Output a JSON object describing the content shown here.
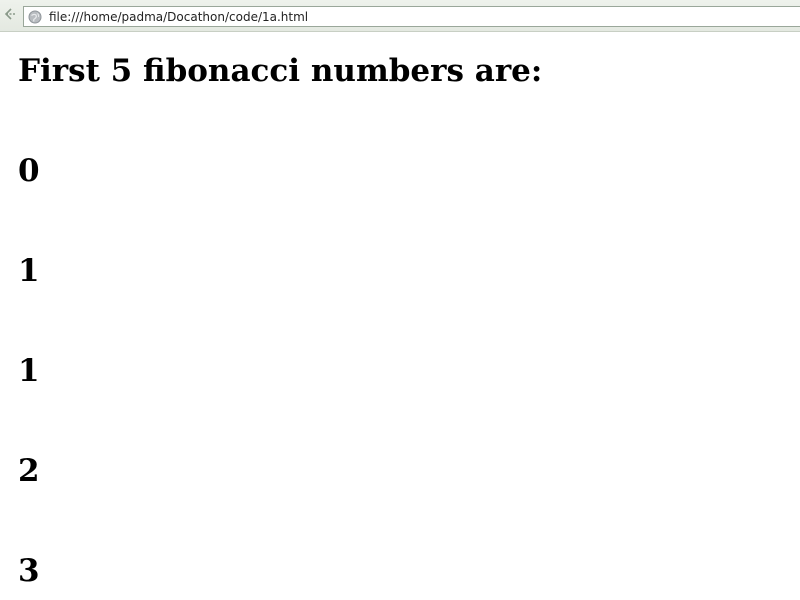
{
  "browser": {
    "url": "file:///home/padma/Docathon/code/1a.html",
    "icons": {
      "back": "back-arrow-icon",
      "site": "globe-icon"
    }
  },
  "page": {
    "title": "First 5 fibonacci numbers are:",
    "numbers": [
      "0",
      "1",
      "1",
      "2",
      "3"
    ]
  }
}
